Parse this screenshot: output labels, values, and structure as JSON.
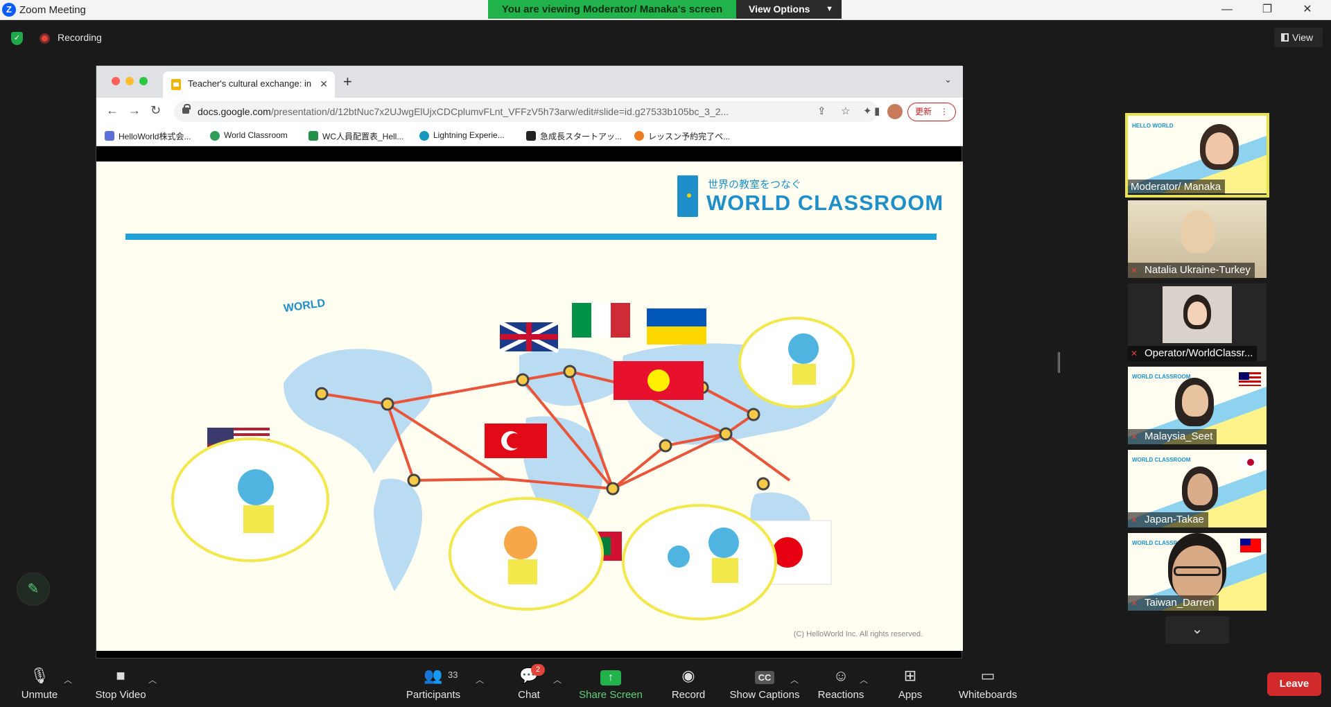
{
  "window": {
    "title": "Zoom Meeting",
    "app_logo": "Z",
    "share_banner": "You are viewing Moderator/ Manaka's screen",
    "view_options": "View Options",
    "controls": [
      "—",
      "❐",
      "✕"
    ]
  },
  "meeting": {
    "recording_label": "Recording",
    "view_label": "View"
  },
  "browser": {
    "tab_title": "Teacher's cultural exchange: in",
    "url_domain": "docs.google.com",
    "url_path": "/presentation/d/12btNuc7x2UJwgElUjxCDCplumvFLnt_VFFzV5h73arw/edit#slide=id.g27533b105bc_3_2...",
    "update_label": "更新",
    "bookmarks": [
      {
        "label": "HelloWorld株式会...",
        "color": "#5b6fd6"
      },
      {
        "label": "World Classroom",
        "color": "#2e9e5a"
      },
      {
        "label": "WC人員配置表_Hell...",
        "color": "#1f8f4a"
      },
      {
        "label": "Lightning Experie...",
        "color": "#1798c1"
      },
      {
        "label": "急成長スタートアッ...",
        "color": "#222222"
      },
      {
        "label": "レッスン予約完了ペ...",
        "color": "#f07c22"
      }
    ]
  },
  "slide": {
    "logo_tagline": "世界の教室をつなぐ",
    "logo_name": "WORLD CLASSROOM",
    "map_label": "WORLD",
    "copyright": "(C) HelloWorld Inc. All rights reserved."
  },
  "participants": [
    {
      "name": "Moderator/ Manaka",
      "muted": false,
      "active": true
    },
    {
      "name": "Natalia Ukraine-Turkey",
      "muted": true,
      "active": false
    },
    {
      "name": "Operator/WorldClassr...",
      "muted": true,
      "active": false
    },
    {
      "name": "Malaysia_Seet",
      "muted": true,
      "active": false
    },
    {
      "name": "Japan-Takae",
      "muted": true,
      "active": false
    },
    {
      "name": "Taiwan_Darren",
      "muted": true,
      "active": false
    }
  ],
  "toolbar": {
    "unmute": "Unmute",
    "stop_video": "Stop Video",
    "participants": "Participants",
    "participants_count": "33",
    "chat": "Chat",
    "chat_badge": "2",
    "share_screen": "Share Screen",
    "record": "Record",
    "show_captions": "Show Captions",
    "captions_icon": "CC",
    "reactions": "Reactions",
    "apps": "Apps",
    "whiteboards": "Whiteboards",
    "leave": "Leave"
  },
  "colors": {
    "share_green": "#22b24c",
    "leave_red": "#d22a2a",
    "active_speaker": "#e8e34a",
    "brand_blue": "#1e8fc8"
  }
}
